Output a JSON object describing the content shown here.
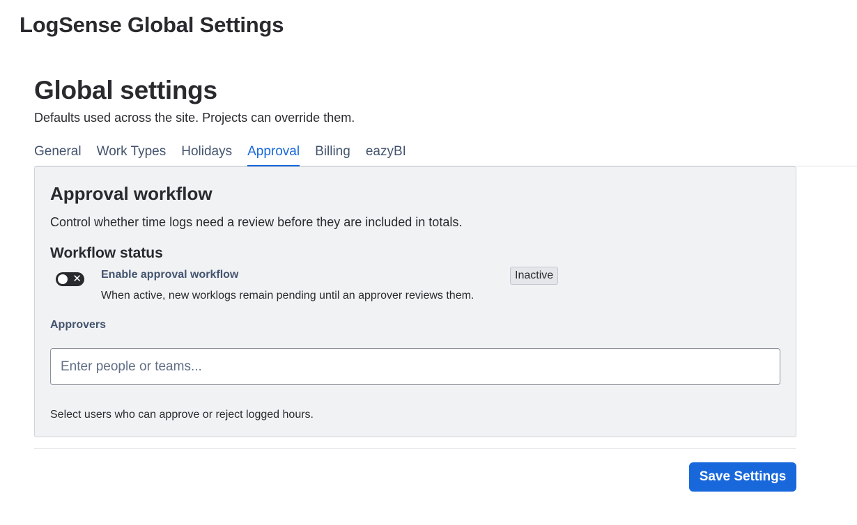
{
  "app": {
    "title": "LogSense Global Settings"
  },
  "page": {
    "title": "Global settings",
    "subtitle": "Defaults used across the site. Projects can override them."
  },
  "tabs": [
    {
      "label": "General",
      "active": false
    },
    {
      "label": "Work Types",
      "active": false
    },
    {
      "label": "Holidays",
      "active": false
    },
    {
      "label": "Approval",
      "active": true
    },
    {
      "label": "Billing",
      "active": false
    },
    {
      "label": "eazyBI",
      "active": false
    }
  ],
  "approval": {
    "title": "Approval workflow",
    "description": "Control whether time logs need a review before they are included in totals.",
    "workflow_status": {
      "title": "Workflow status",
      "toggle_label": "Enable approval workflow",
      "toggle_help": "When active, new worklogs remain pending until an approver reviews them.",
      "toggle_on": false,
      "toggle_off_glyph": "✕",
      "status_badge": "Inactive"
    },
    "approvers": {
      "label": "Approvers",
      "value": "",
      "placeholder": "Enter people or teams...",
      "help": "Select users who can approve or reject logged hours."
    }
  },
  "footer": {
    "save_label": "Save Settings"
  },
  "colors": {
    "accent": "#1868db",
    "text": "#292a2e",
    "panel_bg": "#f1f2f4",
    "toggle_off": "#292a2e"
  }
}
